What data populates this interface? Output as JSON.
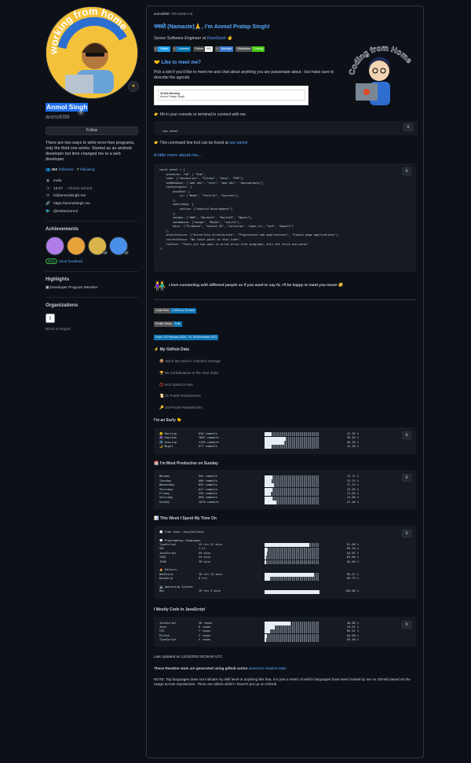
{
  "profile": {
    "avatar_text": "working from home",
    "name": "Anmol Singh",
    "username": "anmol098",
    "status_icon": "target-icon",
    "follow_label": "Follow",
    "bio": "There are two ways to write error-free programs, only the third one works. Started as an android developer but time changed me to a web developer.",
    "followers": "452",
    "followers_label": "followers",
    "following": "7",
    "following_label": "following",
    "location": "India",
    "time": "13:47",
    "time_note": "- 5h30m behind",
    "email": "hi@anmolsingh.me",
    "website": "https://anmolsingh.me",
    "twitter": "@misteranmol",
    "achievements_title": "Achievements",
    "achievements": [
      {
        "color": "#b07de8",
        "count": ""
      },
      {
        "color": "#e8a23a",
        "count": ""
      },
      {
        "color": "#d9b44a",
        "count": "x3"
      },
      {
        "color": "#4a8fe8",
        "count": "x2"
      }
    ],
    "beta_tag": "Beta",
    "beta_link": "Send feedback",
    "highlights_title": "Highlights",
    "highlight": "Developer Program Member",
    "orgs_title": "Organizations",
    "block": "Block or Report"
  },
  "readme": {
    "breadcrumb_user": "anmol098",
    "breadcrumb_file": "README.md",
    "greeting": "नमस्ते (Namaste)🙏, I'm Anmol Pratap Singh!",
    "role_prefix": "Senior Software Engineer at ",
    "role_company": "DoorDash",
    "shields": [
      {
        "l": "",
        "r": "Twitter",
        "lc": "#555",
        "rc": "#1da1f2"
      },
      {
        "l": "",
        "r": "Linkedin",
        "lc": "#555",
        "rc": "#0077b5"
      },
      {
        "l": "Follow",
        "r": "452",
        "lc": "#444",
        "rc": "#fff"
      },
      {
        "l": "",
        "r": "Website",
        "lc": "#555",
        "rc": "#3a7bd5"
      },
      {
        "l": "Wakatime",
        "r": "Coding",
        "lc": "#555",
        "rc": "#4c1"
      }
    ],
    "meet_title": "Like to meet me?",
    "meet_text": "Pick a slot if you'd like to meet me and chat about anything you are passionate about - but make sure to describe the agenda",
    "cal_title": "30 Min Meeting",
    "cal_sub": "Anmol Pratap Singh",
    "hero_text": "Coding from Home",
    "terminal_text": "Hit in your console or terminal to connect with me.",
    "npx_cmd": "npx anmol",
    "npx_note": "This command line tool can be found at ",
    "npx_link": "npx anmol",
    "more_title": "A little more about me...",
    "code_lines": [
      "const anmol = {",
      "    pronouns: \"He\" | \"Him\",",
      "    code: [\"Javascript\", \"Python\", \"Java\", \"PHP\"],",
      "    askMeAbout: [\"web dev\", \"tech\", \"app dev\", \"photography\"],",
      "    technologies: {",
      "        backEnd: {",
      "            js: [\"Node\", \"Fastify\", \"Express\"],",
      "        },",
      "        mobileApp: {",
      "            native: [\"Android Development\"]",
      "        },",
      "        devOps: [\"AWS\", \"Dockerk\", \"Route53\", \"Nginx\"],",
      "        databases: [\"mongo\", \"MySQL\", \"sqlite\"],",
      "        misc: [\"Firebase\", \"Socket.IO\", \"selenium\", \"open-cv\", \"bs4\", \"OpenCV\"]",
      "    },",
      "    architecture: [\"Serverless Architecture\", \"Progressive web applications\", \"Single page applications\"],",
      "    currentFocus: \"No focus point at this time\",",
      "    funFact: \"There are two ways to write error-free programs; only the third one works\"",
      "};"
    ],
    "connect_text": "I love connecting with different people so if you want to say hi, I'll be happy to meet you more! 😊",
    "badges": [
      {
        "l": "Code Time",
        "r": "2,405 hrs 33 mins",
        "lc": "#555",
        "rc": "#0e75b6"
      },
      {
        "l": "Profile Views",
        "r": "5.8k",
        "lc": "#555",
        "rc": "#0e75b6"
      },
      {
        "l": "From: 20 February 2020 - To: 28 November 2023",
        "r": "",
        "lc": "#555",
        "rc": "#0e75b6"
      }
    ],
    "ghd_title": "My GitHub Data",
    "ghd": [
      "📦 183.9 kB Used in GitHub's Storage",
      "🏆 95 Contributions in the Year 2023",
      "🚫 Not Opted to Hire",
      "📜 21 Public Repositories",
      "🔑 23 Private Repositories"
    ],
    "early_title": "I'm an Early 🐤",
    "early": [
      {
        "n": "🌞 Morning",
        "c": "626 commits",
        "p": "12.35 %",
        "v": 12.35
      },
      {
        "n": "🌆 Daytime",
        "c": "1687 commits",
        "p": "38.05 %",
        "v": 38.05
      },
      {
        "n": "🌃 Evening",
        "c": "1169 commits",
        "p": "36.30 %",
        "v": 36.3
      },
      {
        "n": "🌙 Night",
        "c": "977 commits",
        "p": "12.30 %",
        "v": 12.3
      }
    ],
    "sunday_title": "📅 I'm Most Productive on Sunday",
    "days": [
      {
        "n": "Monday",
        "c": "594 commits",
        "p": "13.71 %",
        "v": 13.71
      },
      {
        "n": "Tuesday",
        "c": "600 commits",
        "p": "13.22 %",
        "v": 13.22
      },
      {
        "n": "Wednesday",
        "c": "855 commits",
        "p": "17.15 %",
        "v": 17.15
      },
      {
        "n": "Thursday",
        "c": "617 commits",
        "p": "13.59 %",
        "v": 13.59
      },
      {
        "n": "Friday",
        "c": "255 commits",
        "p": "11.65 %",
        "v": 11.65
      },
      {
        "n": "Saturday",
        "c": "690 commits",
        "p": "14.88 %",
        "v": 14.88
      },
      {
        "n": "Sunday",
        "c": "1070 commits",
        "p": "21.46 %",
        "v": 21.46
      }
    ],
    "week_title": "📊 This Week I Spent My Time On",
    "tz": "🕑 Time Zone: Asia/Kolkata",
    "lang_head": "💬 Programming Languages:",
    "langs": [
      {
        "n": "TypeScript",
        "c": "15 hrs 47 mins",
        "p": "81.88 %",
        "v": 81.88
      },
      {
        "n": "SQL",
        "c": "1 hr",
        "p": "05.20 %",
        "v": 5.2
      },
      {
        "n": "JavaScript",
        "c": "45 mins",
        "p": "04.02 %",
        "v": 4.02
      },
      {
        "n": "YAML",
        "c": "34 mins",
        "p": "03.00 %",
        "v": 3.0
      },
      {
        "n": "JSON",
        "c": "30 mins",
        "p": "02.60 %",
        "v": 2.6
      }
    ],
    "ed_head": "🔥 Editors:",
    "editors": [
      {
        "n": "WebStorm",
        "c": "10 hrs 15 mins",
        "p": "90.27 %",
        "v": 90.27
      },
      {
        "n": "DataGrip",
        "c": "8 hrs",
        "p": "09.73 %",
        "v": 9.73
      }
    ],
    "os_head": "💻 Operating System:",
    "os": [
      {
        "n": "Mac",
        "c": "19 hrs 3 mins",
        "p": "100.00 %",
        "v": 100
      }
    ],
    "js_title": "I Mostly Code in JavaScript",
    "repos": [
      {
        "n": "JavaScript",
        "c": "26 repos",
        "p": "46.88 %",
        "v": 46.88
      },
      {
        "n": "Java",
        "c": "8 repos",
        "p": "19.07 %",
        "v": 19.07
      },
      {
        "n": "CSS",
        "c": "7 repos",
        "p": "09.31 %",
        "v": 9.31
      },
      {
        "n": "Python",
        "c": "3 repos",
        "p": "04.00 %",
        "v": 4.0
      },
      {
        "n": "TypeScript",
        "c": "3 repos",
        "p": "03.48 %",
        "v": 3.48
      }
    ],
    "updated": "Last Updated on 12/11/2023 00:29:06 UTC",
    "gen_prefix": "These Readme stats are generated using github action ",
    "gen_link": "awesome-readme-stats",
    "note": "NOTE: Top languages does not indicate my skill level or anything like that, it is just a metric of which languages have been hosted by me on GitHub based on the usage across repositories. There are others which I haven't put up on GitHub."
  }
}
